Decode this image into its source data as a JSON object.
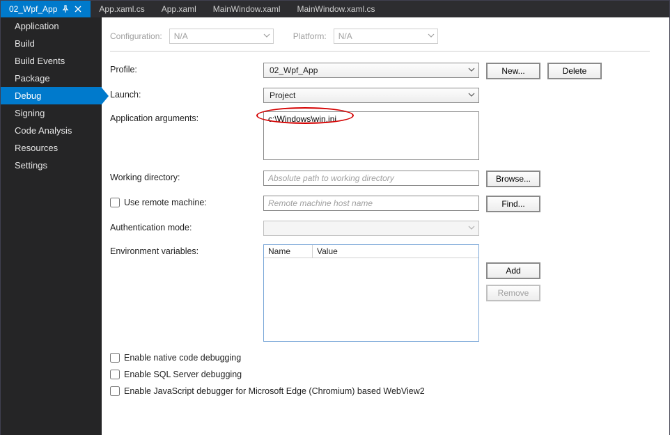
{
  "tabs": [
    {
      "label": "02_Wpf_App",
      "active": true,
      "pinned": true
    },
    {
      "label": "App.xaml.cs",
      "active": false
    },
    {
      "label": "App.xaml",
      "active": false
    },
    {
      "label": "MainWindow.xaml",
      "active": false
    },
    {
      "label": "MainWindow.xaml.cs",
      "active": false
    }
  ],
  "sidebar": {
    "items": [
      "Application",
      "Build",
      "Build Events",
      "Package",
      "Debug",
      "Signing",
      "Code Analysis",
      "Resources",
      "Settings"
    ],
    "selected": "Debug"
  },
  "config": {
    "configuration_label": "Configuration:",
    "configuration_value": "N/A",
    "platform_label": "Platform:",
    "platform_value": "N/A"
  },
  "form": {
    "profile_label": "Profile:",
    "profile_value": "02_Wpf_App",
    "new_button": "New...",
    "delete_button": "Delete",
    "launch_label": "Launch:",
    "launch_value": "Project",
    "app_args_label": "Application arguments:",
    "app_args_value": "c:\\Windows\\win.ini",
    "working_dir_label": "Working directory:",
    "working_dir_placeholder": "Absolute path to working directory",
    "browse_button": "Browse...",
    "use_remote_label": "Use remote machine:",
    "remote_placeholder": "Remote machine host name",
    "find_button": "Find...",
    "auth_mode_label": "Authentication mode:",
    "env_vars_label": "Environment variables:",
    "env_name_header": "Name",
    "env_value_header": "Value",
    "add_button": "Add",
    "remove_button": "Remove"
  },
  "checks": {
    "native_debug": "Enable native code debugging",
    "sql_debug": "Enable SQL Server debugging",
    "js_debug": "Enable JavaScript debugger for Microsoft Edge (Chromium) based WebView2"
  }
}
